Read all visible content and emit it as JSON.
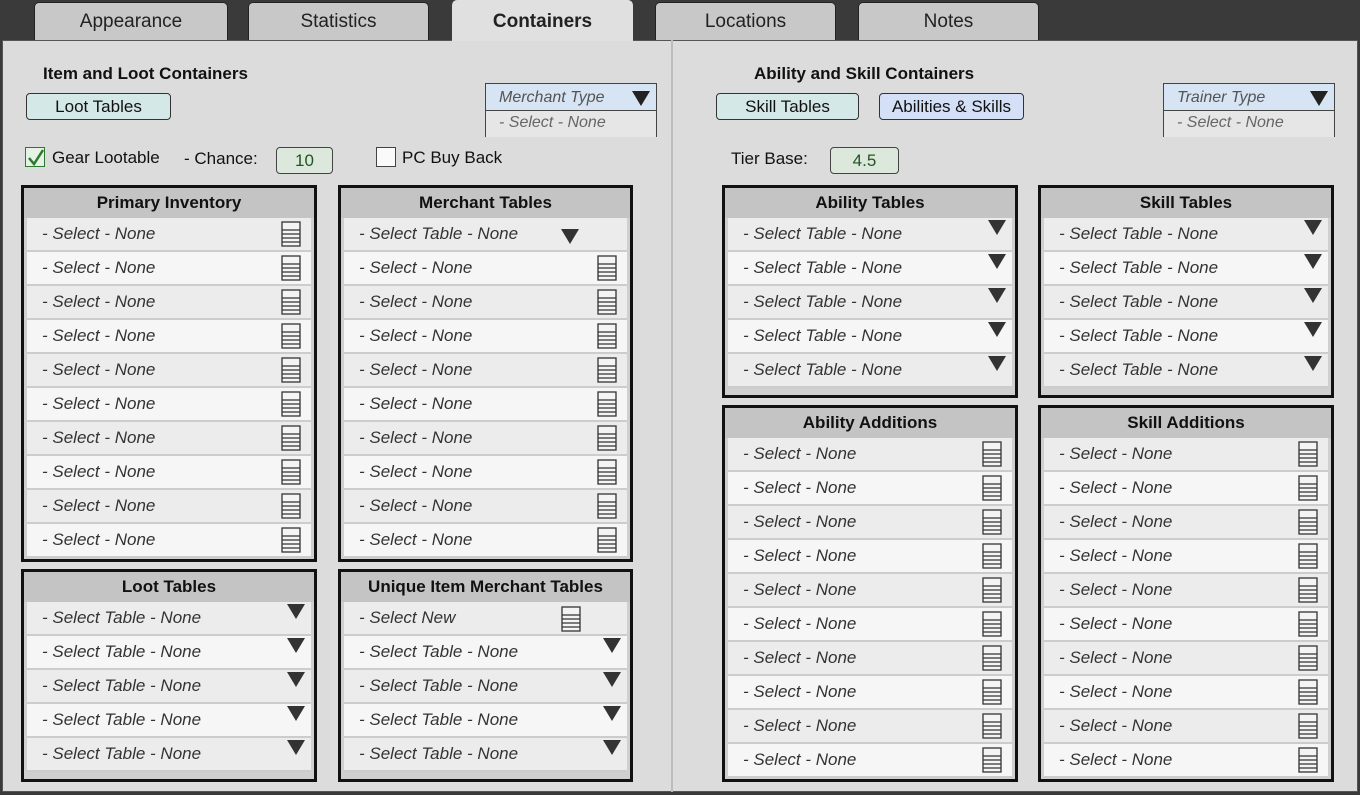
{
  "tabs": [
    "Appearance",
    "Statistics",
    "Containers",
    "Locations",
    "Notes"
  ],
  "active_tab": 2,
  "left": {
    "title": "Item and Loot Containers",
    "loot_tables_button": "Loot Tables",
    "merchant_type": {
      "label": "Merchant Type",
      "value": "- Select - None"
    },
    "gear_lootable": {
      "label": "Gear Lootable",
      "checked": true
    },
    "chance": {
      "label": "- Chance:",
      "value": "10"
    },
    "pc_buy_back": {
      "label": "PC Buy Back",
      "checked": false
    },
    "primary_inventory": {
      "title": "Primary Inventory",
      "rows": [
        "- Select -  None",
        "- Select -  None",
        "- Select -  None",
        "- Select -  None",
        "- Select -  None",
        "- Select -  None",
        "- Select -  None",
        "- Select -  None",
        "- Select -  None",
        "- Select -  None"
      ]
    },
    "merchant_tables": {
      "title": "Merchant  Tables",
      "first_row": "- Select Table -  None",
      "rows": [
        "- Select -  None",
        "- Select -  None",
        "- Select -  None",
        "- Select -  None",
        "- Select -  None",
        "- Select -  None",
        "- Select -  None",
        "- Select -  None",
        "- Select -  None"
      ]
    },
    "loot_tables": {
      "title": "Loot Tables",
      "rows": [
        "- Select Table -  None",
        "- Select Table -  None",
        "- Select Table -  None",
        "- Select Table -  None",
        "- Select Table -  None"
      ]
    },
    "unique_item_merchant_tables": {
      "title": "Unique Item Merchant Tables",
      "first_row": "- Select New",
      "rows": [
        "- Select Table -  None",
        "- Select Table -  None",
        "- Select Table -  None",
        "- Select Table -  None"
      ]
    }
  },
  "right": {
    "title": "Ability and Skill  Containers",
    "skill_tables_button": "Skill Tables",
    "abilities_skills_button": "Abilities & Skills",
    "trainer_type": {
      "label": "Trainer Type",
      "value": "- Select - None"
    },
    "tier_base": {
      "label": "Tier Base:",
      "value": "4.5"
    },
    "ability_tables": {
      "title": "Ability Tables",
      "rows": [
        "- Select Table -  None",
        "- Select Table -  None",
        "- Select Table -  None",
        "- Select Table -  None",
        "- Select Table -  None"
      ]
    },
    "skill_tables": {
      "title": "Skill Tables",
      "rows": [
        "- Select Table -  None",
        "- Select Table -  None",
        "- Select Table -  None",
        "- Select Table -  None",
        "- Select Table -  None"
      ]
    },
    "ability_additions": {
      "title": "Ability Additions",
      "rows": [
        "- Select -  None",
        "- Select -  None",
        "- Select -  None",
        "- Select -  None",
        "- Select -  None",
        "- Select -  None",
        "- Select -  None",
        "- Select -  None",
        "- Select -  None",
        "- Select -  None"
      ]
    },
    "skill_additions": {
      "title": "Skill Additions",
      "rows": [
        "- Select -  None",
        "- Select -  None",
        "- Select -  None",
        "- Select -  None",
        "- Select -  None",
        "- Select -  None",
        "- Select -  None",
        "- Select -  None",
        "- Select -  None",
        "- Select -  None"
      ]
    }
  },
  "icons": {
    "list": "list-icon",
    "dropdown": "dropdown-triangle-icon",
    "check": "checkmark-icon"
  },
  "colors": {
    "check": "#2d7a2d",
    "tier_text": "#225522"
  }
}
